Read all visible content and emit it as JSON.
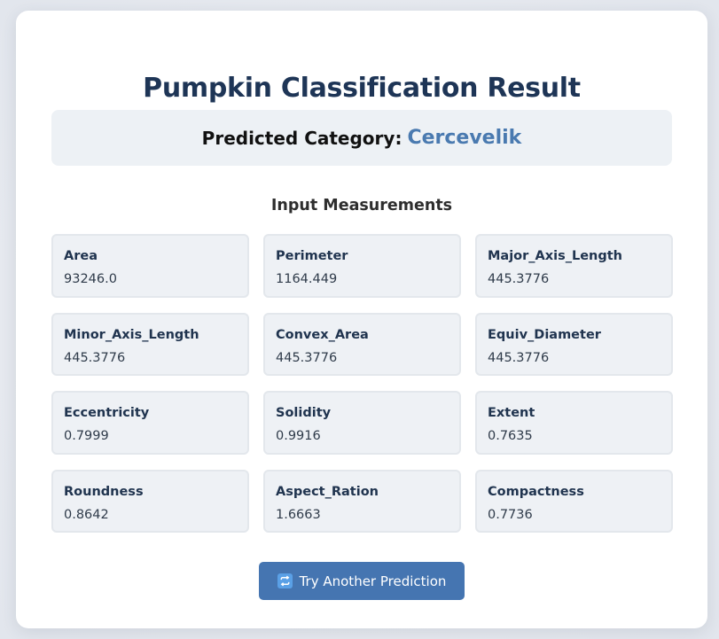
{
  "page": {
    "title": "Pumpkin Classification Result"
  },
  "prediction": {
    "label": "Predicted Category:",
    "value": "Cercevelik"
  },
  "measurements": {
    "heading": "Input Measurements",
    "items": [
      {
        "label": "Area",
        "value": "93246.0"
      },
      {
        "label": "Perimeter",
        "value": "1164.449"
      },
      {
        "label": "Major_Axis_Length",
        "value": "445.3776"
      },
      {
        "label": "Minor_Axis_Length",
        "value": "445.3776"
      },
      {
        "label": "Convex_Area",
        "value": "445.3776"
      },
      {
        "label": "Equiv_Diameter",
        "value": "445.3776"
      },
      {
        "label": "Eccentricity",
        "value": "0.7999"
      },
      {
        "label": "Solidity",
        "value": "0.9916"
      },
      {
        "label": "Extent",
        "value": "0.7635"
      },
      {
        "label": "Roundness",
        "value": "0.8642"
      },
      {
        "label": "Aspect_Ration",
        "value": "1.6663"
      },
      {
        "label": "Compactness",
        "value": "0.7736"
      }
    ]
  },
  "button": {
    "label": "Try Another Prediction",
    "icon": "repeat-icon"
  },
  "colors": {
    "title": "#1e3556",
    "accent": "#4a7ab0",
    "button": "#4575b1",
    "cell_bg": "#eef1f5"
  }
}
